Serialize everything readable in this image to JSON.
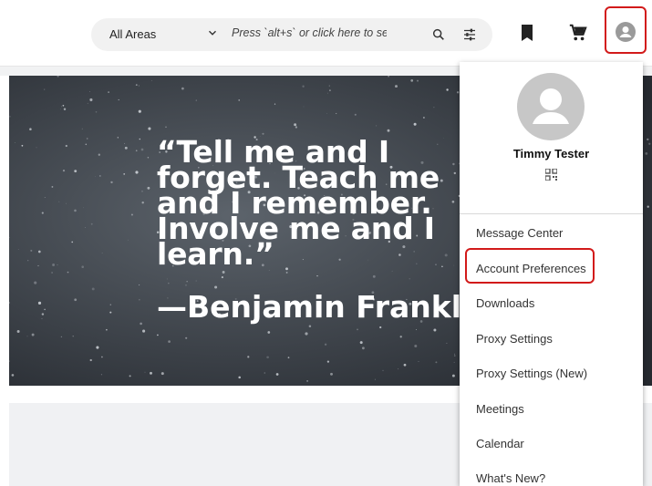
{
  "header": {
    "area_select": "All Areas",
    "search_placeholder": "Press `alt+s` or click here to search",
    "icons": [
      "chevron-down-icon",
      "search-icon",
      "tune-icon",
      "bookmark-icon",
      "cart-icon",
      "account-icon"
    ]
  },
  "hero": {
    "quote": "“Tell me and I forget. Teach me and I remember. Involve me and I learn.”",
    "attribution": "—Benjamin Franklin"
  },
  "user_menu": {
    "user_name": "Timmy Tester",
    "items": [
      "Message Center",
      "Account Preferences",
      "Downloads",
      "Proxy Settings",
      "Proxy Settings (New)",
      "Meetings",
      "Calendar",
      "What's New?"
    ]
  },
  "colors": {
    "highlight": "#d21a1a",
    "search_bg": "#f1f1f1",
    "avatar_gray": "#c7c7c7"
  }
}
